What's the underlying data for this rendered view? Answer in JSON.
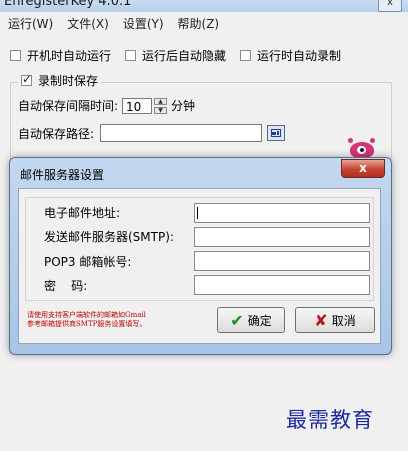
{
  "window": {
    "title": "EnregisterKey 4.0.1",
    "close_glyph": "x"
  },
  "menu": [
    {
      "label": "运行(W)"
    },
    {
      "label": "文件(X)"
    },
    {
      "label": "设置(Y)"
    },
    {
      "label": "帮助(Z)"
    }
  ],
  "options": {
    "autorun_startup": {
      "label": "开机时自动运行",
      "checked": false
    },
    "autohide_after_run": {
      "label": "运行后自动隐藏",
      "checked": false
    },
    "autorecord_when_run": {
      "label": "运行时自动录制",
      "checked": false
    }
  },
  "save_group": {
    "legend": "录制时保存",
    "checked": true,
    "interval_label": "自动保存间隔时间:",
    "interval_value": "10",
    "interval_unit": "分钟",
    "path_label": "自动保存路径:",
    "path_value": ""
  },
  "dialog": {
    "title": "邮件服务器设置",
    "close_glyph": "x",
    "fields": [
      {
        "label": "电子邮件地址:",
        "value": ""
      },
      {
        "label": "发送邮件服务器(SMTP):",
        "value": ""
      },
      {
        "label": "POP3 邮箱帐号:",
        "value": ""
      },
      {
        "label": "密    码:",
        "value": ""
      }
    ],
    "hint_lines": [
      "请使用支持客户端软件的邮箱如Gmail",
      "参考邮箱提供商SMTP服务设置填写。"
    ],
    "ok_label": "确定",
    "cancel_label": "取消"
  },
  "watermark": "最需教育",
  "colors": {
    "hint_red": "#c00000",
    "ok_green": "#1d8a1d",
    "cancel_red": "#b8161b",
    "watermark_blue": "#1f2a9e"
  }
}
